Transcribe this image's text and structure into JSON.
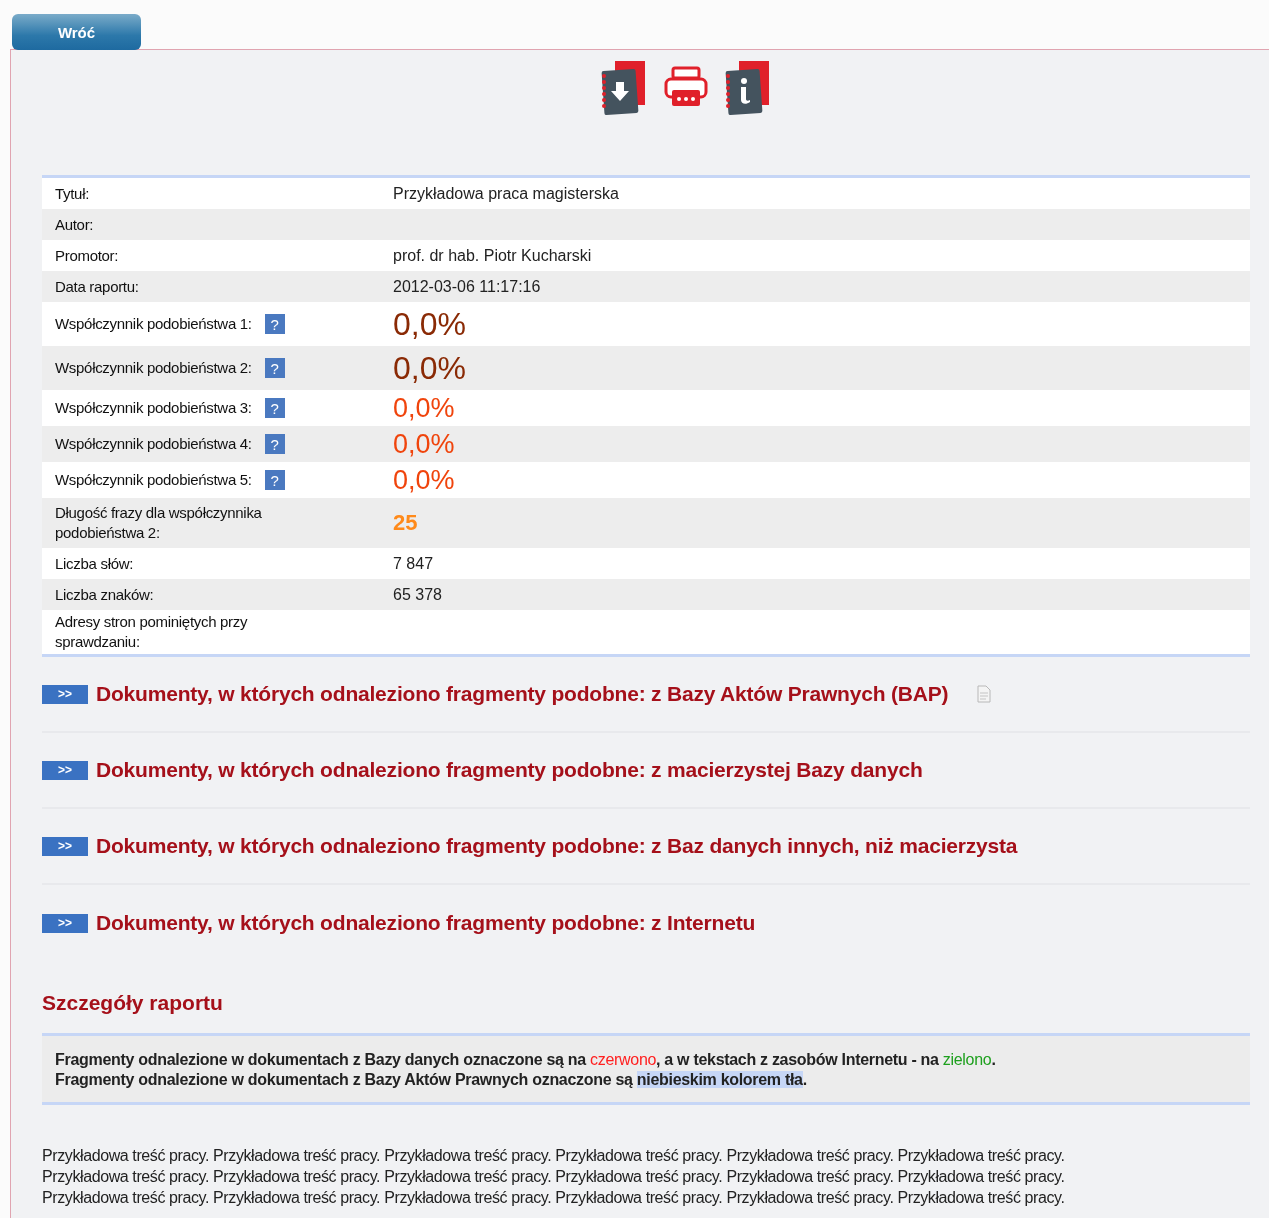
{
  "back_button": "Wróć",
  "toolbar": [
    {
      "kind": "download"
    },
    {
      "kind": "print"
    },
    {
      "kind": "info"
    }
  ],
  "details": [
    {
      "label": "Tytuł:",
      "value": "Przykładowa praca magisterska",
      "kind": "plain"
    },
    {
      "label": "Autor:"
    },
    {
      "label": "Promotor:",
      "value": "prof. dr hab. Piotr Kucharski",
      "kind": "plain"
    },
    {
      "label": "Data raportu:",
      "value": "2012-03-06 11:17:16",
      "kind": "plain"
    },
    {
      "label": "Współczynnik podobieństwa 1:",
      "value": "0,0%",
      "kind": "major",
      "help_icon": "?"
    },
    {
      "label": "Współczynnik podobieństwa 2:",
      "value": "0,0%",
      "kind": "major",
      "help_icon": "?"
    },
    {
      "label": "Współczynnik podobieństwa 3:",
      "value": "0,0%",
      "kind": "minor",
      "help_icon": "?"
    },
    {
      "label": "Współczynnik podobieństwa 4:",
      "value": "0,0%",
      "kind": "minor",
      "help_icon": "?"
    },
    {
      "label": "Współczynnik podobieństwa 5:",
      "value": "0,0%",
      "kind": "minor",
      "help_icon": "?"
    },
    {
      "label": "Długość frazy dla współczynnika podobieństwa 2:",
      "value": "25",
      "kind": "phrase"
    },
    {
      "label": "Liczba słów:",
      "value": "7 847",
      "kind": "plain"
    },
    {
      "label": "Liczba znaków:",
      "value": "65 378",
      "kind": "plain"
    },
    {
      "label": "Adresy stron pominiętych przy sprawdzaniu:"
    }
  ],
  "sections": [
    {
      "toggle": ">>",
      "title": "Dokumenty, w których odnaleziono fragmenty podobne: z Bazy Aktów Prawnych (BAP)",
      "doc_icon": true
    },
    {
      "toggle": ">>",
      "title": "Dokumenty, w których odnaleziono fragmenty podobne: z macierzystej Bazy danych"
    },
    {
      "toggle": ">>",
      "title": "Dokumenty, w których odnaleziono fragmenty podobne: z Baz danych innych, niż macierzysta"
    },
    {
      "toggle": ">>",
      "title": "Dokumenty, w których odnaleziono fragmenty podobne: z Internetu"
    }
  ],
  "report_heading": "Szczegóły raportu",
  "legend": [
    [
      {
        "kind": "plain",
        "text": "Fragmenty odnalezione w dokumentach z Bazy danych oznaczone są na "
      },
      {
        "kind": "red",
        "text": "czerwono"
      },
      {
        "kind": "plain",
        "text": ", a w tekstach z zasobów Internetu - na "
      },
      {
        "kind": "green",
        "text": "zielono"
      },
      {
        "kind": "plain",
        "text": "."
      }
    ],
    [
      {
        "kind": "plain",
        "text": "Fragmenty odnalezione w dokumentach z Bazy Aktów Prawnych oznaczone są "
      },
      {
        "kind": "highlight",
        "text": "niebieskim kolorem tła"
      },
      {
        "kind": "plain",
        "text": "."
      }
    ]
  ],
  "body_lines": [
    "Przykładowa treść pracy. Przykładowa treść pracy. Przykładowa treść pracy. Przykładowa treść pracy. Przykładowa treść pracy. Przykładowa treść pracy.",
    "Przykładowa treść pracy. Przykładowa treść pracy. Przykładowa treść pracy. Przykładowa treść pracy. Przykładowa treść pracy. Przykładowa treść pracy.",
    "Przykładowa treść pracy. Przykładowa treść pracy. Przykładowa treść pracy. Przykładowa treść pracy. Przykładowa treść pracy. Przykładowa treść pracy."
  ]
}
